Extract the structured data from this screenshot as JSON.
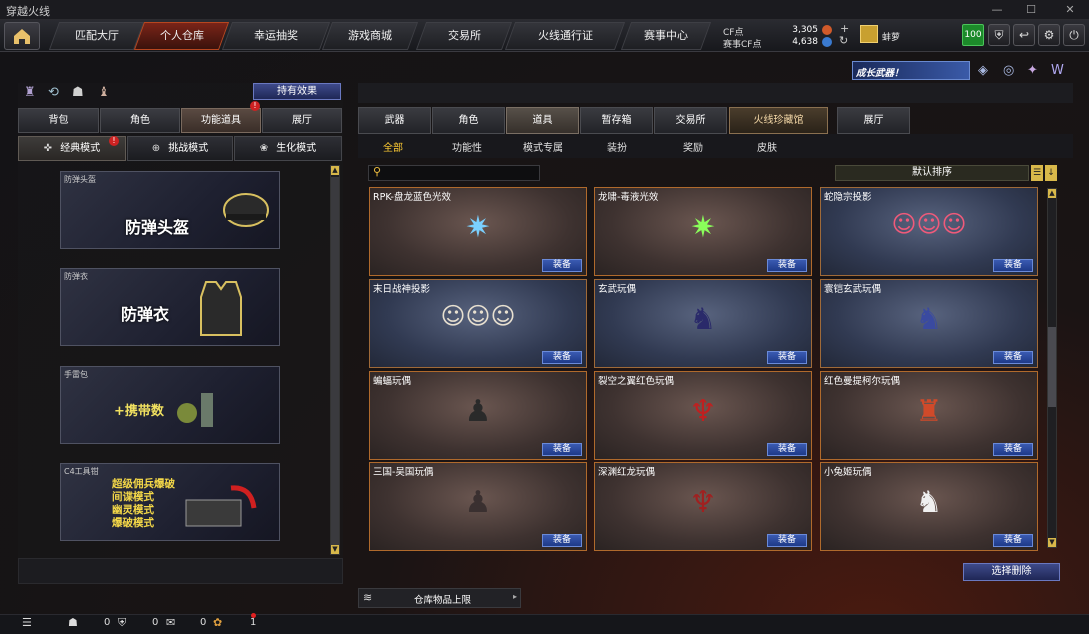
{
  "window": {
    "title": "穿越火线"
  },
  "nav": {
    "tabs": [
      "匹配大厅",
      "个人仓库",
      "幸运抽奖",
      "游戏商城",
      "交易所",
      "火线通行证",
      "赛事中心"
    ],
    "active_index": 1,
    "cf_label": "CF点",
    "cf_value": "3,305",
    "event_cf_label": "赛事CF点",
    "event_cf_value": "4,638",
    "username": "蚌萝",
    "level_badge": "100"
  },
  "left": {
    "holding_effect": "持有效果",
    "tabs": [
      "背包",
      "角色",
      "功能道具",
      "展厅"
    ],
    "active_tab": 2,
    "subtabs": [
      "经典模式",
      "挑战模式",
      "生化模式"
    ],
    "active_subtab": 0,
    "cards": [
      {
        "label": "防弹头盔",
        "big": "防弹头盔"
      },
      {
        "label": "防弹衣",
        "big": "防弹衣"
      },
      {
        "label": "手雷包",
        "big": "+携带数"
      },
      {
        "label": "C4工具钳",
        "lines": [
          "超级佣兵爆破",
          "间谍模式",
          "幽灵模式",
          "爆破模式"
        ]
      }
    ]
  },
  "right": {
    "banner": "成长武器！",
    "tabs": [
      "武器",
      "角色",
      "道具",
      "暂存箱",
      "交易所",
      "火线珍藏馆",
      "展厅"
    ],
    "active_tab": 2,
    "filters": [
      "全部",
      "功能性",
      "模式专属",
      "装扮",
      "奖励",
      "皮肤"
    ],
    "active_filter": 0,
    "search_placeholder": "",
    "sort_label": "默认排序",
    "equip_label": "装备",
    "items": [
      {
        "name": "RPK-盘龙蓝色光效",
        "theme": "warm"
      },
      {
        "name": "龙啸-毒液光效",
        "theme": "warm"
      },
      {
        "name": "蛇隐宗投影",
        "theme": "blue"
      },
      {
        "name": "末日战神投影",
        "theme": "blue"
      },
      {
        "name": "玄武玩偶",
        "theme": "blue"
      },
      {
        "name": "寰铠玄武玩偶",
        "theme": "blue"
      },
      {
        "name": "蝙蝠玩偶",
        "theme": "warm"
      },
      {
        "name": "裂空之翼红色玩偶",
        "theme": "warm"
      },
      {
        "name": "红色曼提柯尔玩偶",
        "theme": "warm"
      },
      {
        "name": "三国-吴国玩偶",
        "theme": "warm"
      },
      {
        "name": "深渊红龙玩偶",
        "theme": "warm"
      },
      {
        "name": "小兔姬玩偶",
        "theme": "warm"
      }
    ],
    "batch_delete": "选择删除",
    "capacity_label": "仓库物品上限"
  },
  "bottom": {
    "counts": [
      "0",
      "0",
      "0",
      "1"
    ]
  },
  "colors": {
    "accent": "#b8461f",
    "equip_blue": "#1e3a88",
    "border_gold": "#b06a2c"
  }
}
